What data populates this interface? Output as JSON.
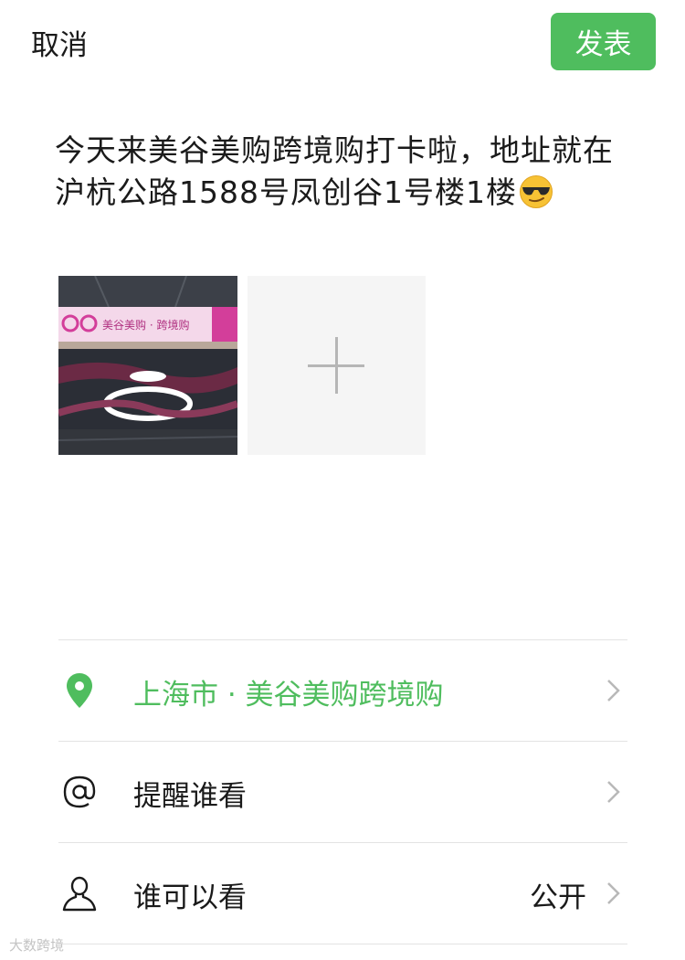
{
  "topbar": {
    "cancel_label": "取消",
    "publish_label": "发表"
  },
  "post": {
    "text": "今天来美谷美购跨境购打卡啦，地址就在沪杭公路1588号凤创谷1号楼1楼",
    "emoji_icon": "sunglasses-emoji"
  },
  "photos": {
    "thumbnail_sign_text": "美谷美购 · 跨境购",
    "add_icon": "plus-icon"
  },
  "options": {
    "location": {
      "icon": "location-pin-icon",
      "label": "上海市 · 美谷美购跨境购",
      "color": "#4fbd5e"
    },
    "mention": {
      "icon": "at-icon",
      "label": "提醒谁看"
    },
    "visibility": {
      "icon": "person-icon",
      "label": "谁可以看",
      "value": "公开"
    }
  },
  "watermark": "大数跨境",
  "colors": {
    "accent": "#4fbd5e",
    "divider": "#e3e3e3"
  }
}
